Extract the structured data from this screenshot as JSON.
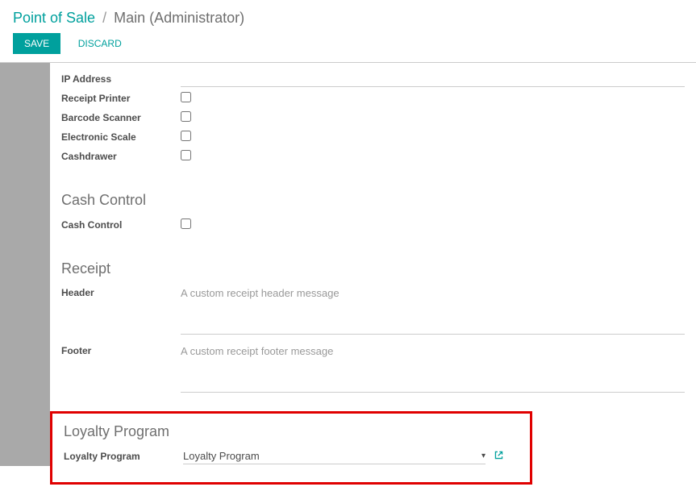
{
  "breadcrumb": {
    "root": "Point of Sale",
    "separator": "/",
    "current": "Main (Administrator)"
  },
  "actions": {
    "save": "Save",
    "discard": "Discard"
  },
  "fields": {
    "ip_address": {
      "label": "IP Address",
      "value": ""
    },
    "receipt_printer": {
      "label": "Receipt Printer"
    },
    "barcode_scanner": {
      "label": "Barcode Scanner"
    },
    "electronic_scale": {
      "label": "Electronic Scale"
    },
    "cashdrawer": {
      "label": "Cashdrawer"
    }
  },
  "sections": {
    "cash_control": {
      "title": "Cash Control",
      "field_label": "Cash Control"
    },
    "receipt": {
      "title": "Receipt",
      "header_label": "Header",
      "header_placeholder": "A custom receipt header message",
      "footer_label": "Footer",
      "footer_placeholder": "A custom receipt footer message"
    },
    "loyalty": {
      "title": "Loyalty Program",
      "field_label": "Loyalty Program",
      "value": "Loyalty Program"
    }
  }
}
